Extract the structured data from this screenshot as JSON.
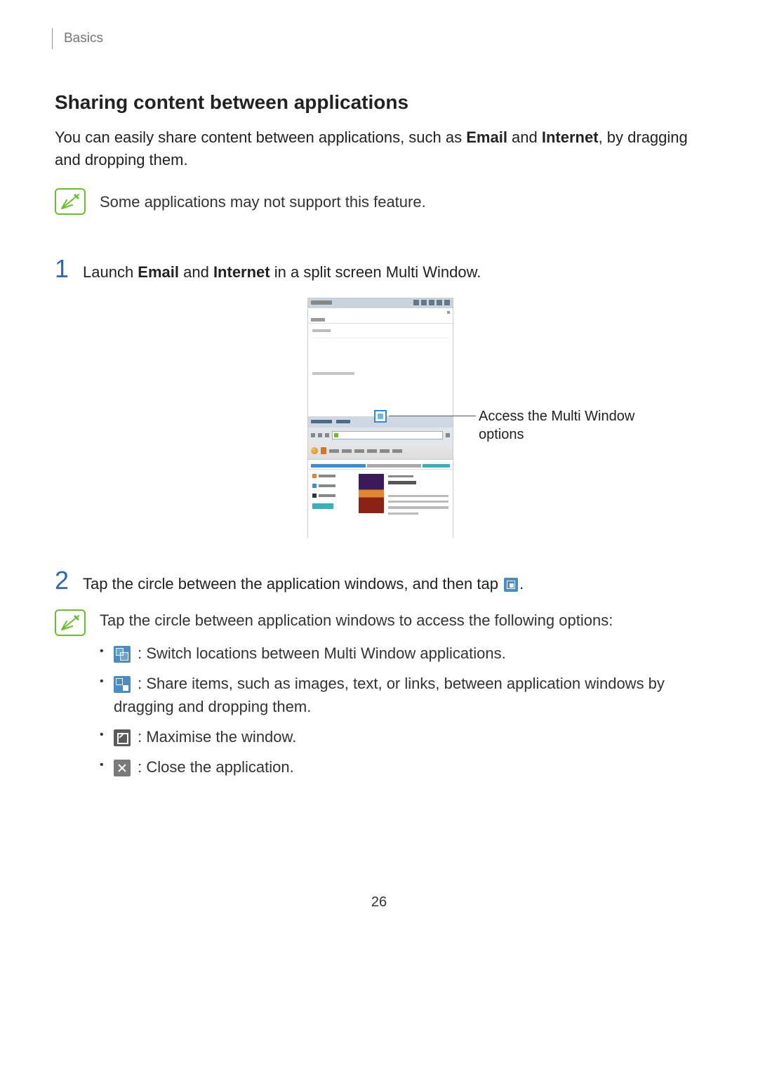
{
  "breadcrumb": "Basics",
  "heading": "Sharing content between applications",
  "intro_pre": "You can easily share content between applications, such as ",
  "intro_email": "Email",
  "intro_mid": " and ",
  "intro_internet": "Internet",
  "intro_post": ", by dragging and dropping them.",
  "note1": "Some applications may not support this feature.",
  "step1_num": "1",
  "step1_pre": "Launch ",
  "step1_email": "Email",
  "step1_and": " and ",
  "step1_internet": "Internet",
  "step1_post": " in a split screen Multi Window.",
  "callout": "Access the Multi Window options",
  "step2_num": "2",
  "step2_pre": "Tap the circle between the application windows, and then tap ",
  "step2_post": ".",
  "note2_intro": "Tap the circle between application windows to access the following options:",
  "bullets": {
    "switch": " : Switch locations between Multi Window applications.",
    "share": " : Share items, such as images, text, or links, between application windows by dragging and dropping them.",
    "maximize": " : Maximise the window.",
    "close": " : Close the application."
  },
  "page_number": "26"
}
